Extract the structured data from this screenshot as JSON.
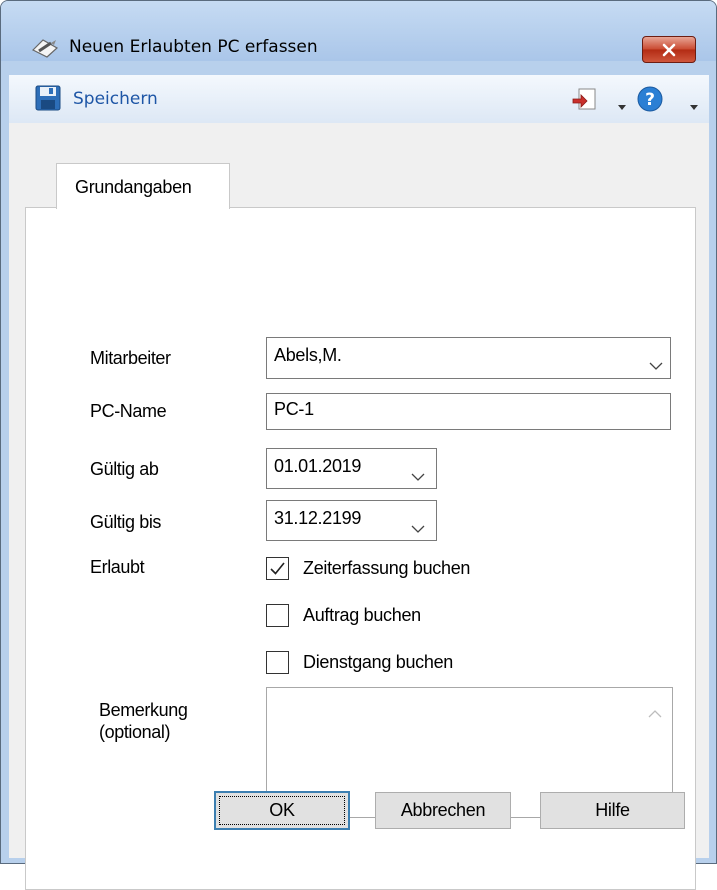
{
  "window": {
    "title": "Neuen Erlaubten PC erfassen"
  },
  "toolbar": {
    "save_label": "Speichern"
  },
  "tabs": [
    {
      "label": "Grundangaben"
    }
  ],
  "form": {
    "mitarbeiter": {
      "label": "Mitarbeiter",
      "value": "Abels,M."
    },
    "pc_name": {
      "label": "PC-Name",
      "value": "PC-1"
    },
    "gueltig_ab": {
      "label": "Gültig ab",
      "value": "01.01.2019"
    },
    "gueltig_bis": {
      "label": "Gültig bis",
      "value": "31.12.2199"
    },
    "erlaubt": {
      "label": "Erlaubt",
      "options": [
        {
          "label": "Zeiterfassung buchen",
          "checked": true
        },
        {
          "label": "Auftrag buchen",
          "checked": false
        },
        {
          "label": "Dienstgang buchen",
          "checked": false
        }
      ]
    },
    "bemerkung": {
      "label_line1": "Bemerkung",
      "label_line2": "(optional)",
      "value": ""
    }
  },
  "buttons": {
    "ok": "OK",
    "cancel": "Abbrechen",
    "help": "Hilfe"
  },
  "icons": {
    "title": "note-pencil-icon",
    "close": "close-icon",
    "save": "floppy-disk-icon",
    "import": "import-icon",
    "help": "help-icon"
  },
  "colors": {
    "accent": "#1e56a6",
    "close_button": "#c9482f",
    "window_frame": "#b8d0ec"
  }
}
